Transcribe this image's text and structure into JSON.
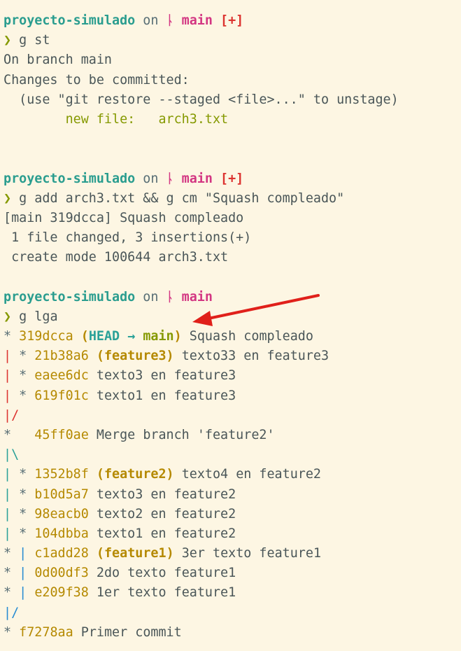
{
  "block1": {
    "prompt": {
      "dir": "proyecto-simulado",
      "on": " on ",
      "branch_icon": "ᚿ",
      "branch": " main",
      "status": " [+]"
    },
    "command": {
      "chevron": "❯",
      "text": " g st"
    },
    "out1": "On branch main",
    "out2": "Changes to be committed:",
    "out3": "  (use \"git restore --staged <file>...\" to unstage)",
    "out4_label": "        new file:   ",
    "out4_file": "arch3.txt"
  },
  "block2": {
    "prompt": {
      "dir": "proyecto-simulado",
      "on": " on ",
      "branch_icon": "ᚿ",
      "branch": " main",
      "status": " [+]"
    },
    "command": {
      "chevron": "❯",
      "text": " g add arch3.txt && g cm \"Squash compleado\""
    },
    "out1": "[main 319dcca] Squash compleado",
    "out2": " 1 file changed, 3 insertions(+)",
    "out3": " create mode 100644 arch3.txt"
  },
  "block3": {
    "prompt": {
      "dir": "proyecto-simulado",
      "on": " on ",
      "branch_icon": "ᚿ",
      "branch": " main"
    },
    "command": {
      "chevron": "❯",
      "text": " g lga"
    }
  },
  "log": [
    {
      "graph": [
        {
          "t": "* ",
          "c": "gray"
        }
      ],
      "hash": "319dcca",
      "refs": [
        {
          "t": " (",
          "c": "yellow"
        },
        {
          "t": "HEAD",
          "c": "cyan"
        },
        {
          "t": " → ",
          "c": "cyan"
        },
        {
          "t": "main",
          "c": "olive"
        },
        {
          "t": ")",
          "c": "yellow"
        }
      ],
      "msg": " Squash compleado"
    },
    {
      "graph": [
        {
          "t": "|",
          "c": "red"
        },
        {
          "t": " * ",
          "c": "gray"
        }
      ],
      "hash": "21b38a6",
      "refs": [
        {
          "t": " (",
          "c": "yellow"
        },
        {
          "t": "feature3",
          "c": "yellow"
        },
        {
          "t": ")",
          "c": "yellow"
        }
      ],
      "msg": " texto33 en feature3"
    },
    {
      "graph": [
        {
          "t": "|",
          "c": "red"
        },
        {
          "t": " * ",
          "c": "gray"
        }
      ],
      "hash": "eaee6dc",
      "refs": [],
      "msg": " texto3 en feature3"
    },
    {
      "graph": [
        {
          "t": "|",
          "c": "red"
        },
        {
          "t": " * ",
          "c": "gray"
        }
      ],
      "hash": "619f01c",
      "refs": [],
      "msg": " texto1 en feature3"
    },
    {
      "graph": [
        {
          "t": "|/",
          "c": "red"
        }
      ],
      "hash": "",
      "refs": [],
      "msg": ""
    },
    {
      "graph": [
        {
          "t": "*   ",
          "c": "gray"
        }
      ],
      "hash": "45ff0ae",
      "refs": [],
      "msg": " Merge branch 'feature2'"
    },
    {
      "graph": [
        {
          "t": "|\\",
          "c": "cyan"
        }
      ],
      "hash": "",
      "refs": [],
      "msg": ""
    },
    {
      "graph": [
        {
          "t": "|",
          "c": "cyan"
        },
        {
          "t": " * ",
          "c": "gray"
        }
      ],
      "hash": "1352b8f",
      "refs": [
        {
          "t": " (",
          "c": "yellow"
        },
        {
          "t": "feature2",
          "c": "yellow"
        },
        {
          "t": ")",
          "c": "yellow"
        }
      ],
      "msg": " texto4 en feature2"
    },
    {
      "graph": [
        {
          "t": "|",
          "c": "cyan"
        },
        {
          "t": " * ",
          "c": "gray"
        }
      ],
      "hash": "b10d5a7",
      "refs": [],
      "msg": " texto3 en feature2"
    },
    {
      "graph": [
        {
          "t": "|",
          "c": "cyan"
        },
        {
          "t": " * ",
          "c": "gray"
        }
      ],
      "hash": "98eacb0",
      "refs": [],
      "msg": " texto2 en feature2"
    },
    {
      "graph": [
        {
          "t": "|",
          "c": "cyan"
        },
        {
          "t": " * ",
          "c": "gray"
        }
      ],
      "hash": "104dbba",
      "refs": [],
      "msg": " texto1 en feature2"
    },
    {
      "graph": [
        {
          "t": "* ",
          "c": "gray"
        },
        {
          "t": "|",
          "c": "blue"
        },
        {
          "t": " ",
          "c": "gray"
        }
      ],
      "hash": "c1add28",
      "refs": [
        {
          "t": " (",
          "c": "yellow"
        },
        {
          "t": "feature1",
          "c": "yellow"
        },
        {
          "t": ")",
          "c": "yellow"
        }
      ],
      "msg": " 3er texto feature1"
    },
    {
      "graph": [
        {
          "t": "* ",
          "c": "gray"
        },
        {
          "t": "|",
          "c": "blue"
        },
        {
          "t": " ",
          "c": "gray"
        }
      ],
      "hash": "0d00df3",
      "refs": [],
      "msg": " 2do texto feature1"
    },
    {
      "graph": [
        {
          "t": "* ",
          "c": "gray"
        },
        {
          "t": "|",
          "c": "blue"
        },
        {
          "t": " ",
          "c": "gray"
        }
      ],
      "hash": "e209f38",
      "refs": [],
      "msg": " 1er texto feature1"
    },
    {
      "graph": [
        {
          "t": "|/",
          "c": "blue"
        }
      ],
      "hash": "",
      "refs": [],
      "msg": ""
    },
    {
      "graph": [
        {
          "t": "* ",
          "c": "gray"
        }
      ],
      "hash": "f7278aa",
      "refs": [],
      "msg": " Primer commit"
    }
  ],
  "colors": {
    "background": "#fdf6e3",
    "prompt_dir": "#2a9d8f",
    "branch": "#d33682",
    "status": "#dc322f",
    "hash": "#b58900",
    "arrow": "#e0201a"
  }
}
